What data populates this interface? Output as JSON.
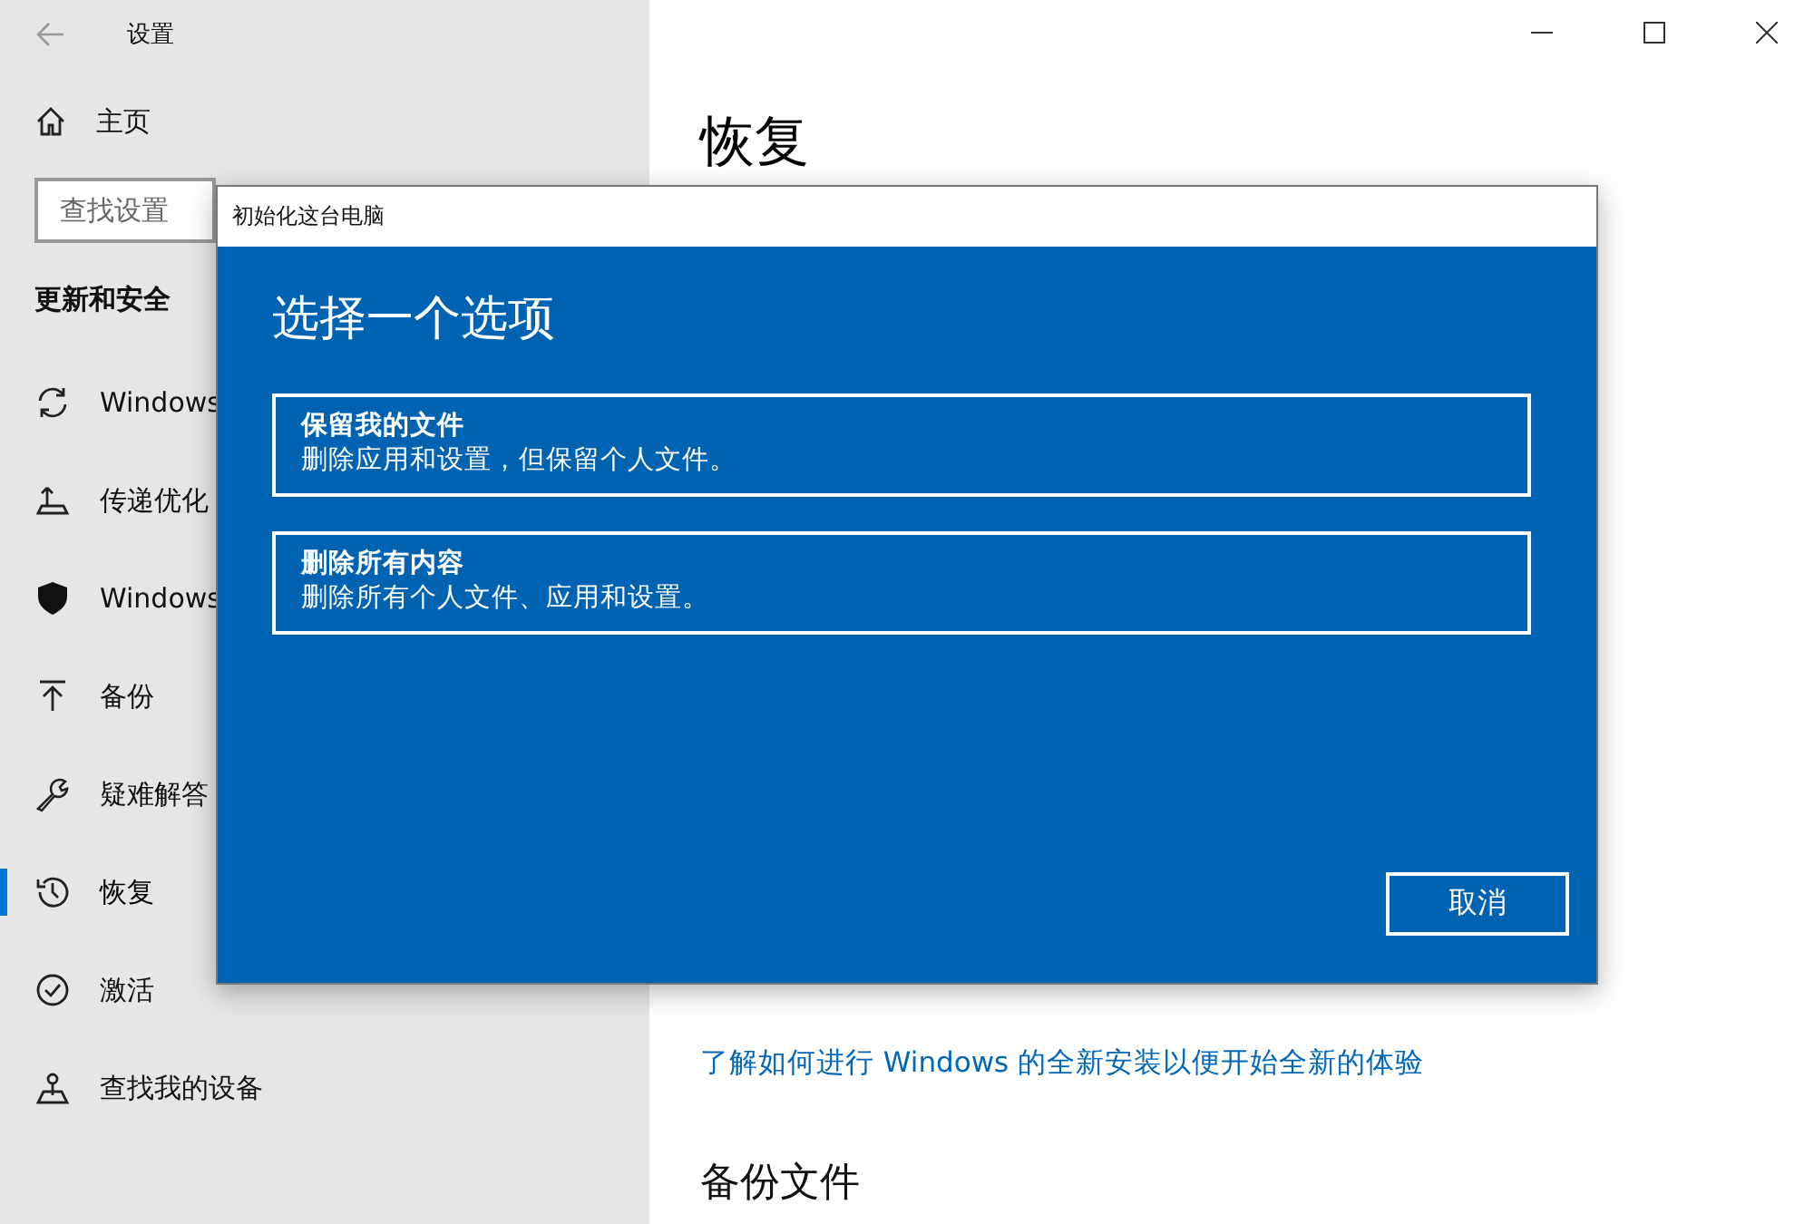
{
  "window": {
    "title": "设置"
  },
  "sidebar": {
    "home": "主页",
    "search": {
      "placeholder": "查找设置"
    },
    "section": "更新和安全",
    "items": [
      {
        "label": "Windows",
        "selected": false
      },
      {
        "label": "传递优化",
        "selected": false
      },
      {
        "label": "Windows",
        "selected": false
      },
      {
        "label": "备份",
        "selected": false
      },
      {
        "label": "疑难解答",
        "selected": false
      },
      {
        "label": "恢复",
        "selected": true
      },
      {
        "label": "激活",
        "selected": false
      },
      {
        "label": "查找我的设备",
        "selected": false
      }
    ]
  },
  "main": {
    "heading": "恢复",
    "link": "了解如何进行 Windows 的全新安装以便开始全新的体验",
    "section_heading": "备份文件"
  },
  "dialog": {
    "title": "初始化这台电脑",
    "heading": "选择一个选项",
    "options": [
      {
        "title": "保留我的文件",
        "description": "删除应用和设置，但保留个人文件。"
      },
      {
        "title": "删除所有内容",
        "description": "删除所有个人文件、应用和设置。"
      }
    ],
    "cancel": "取消"
  }
}
